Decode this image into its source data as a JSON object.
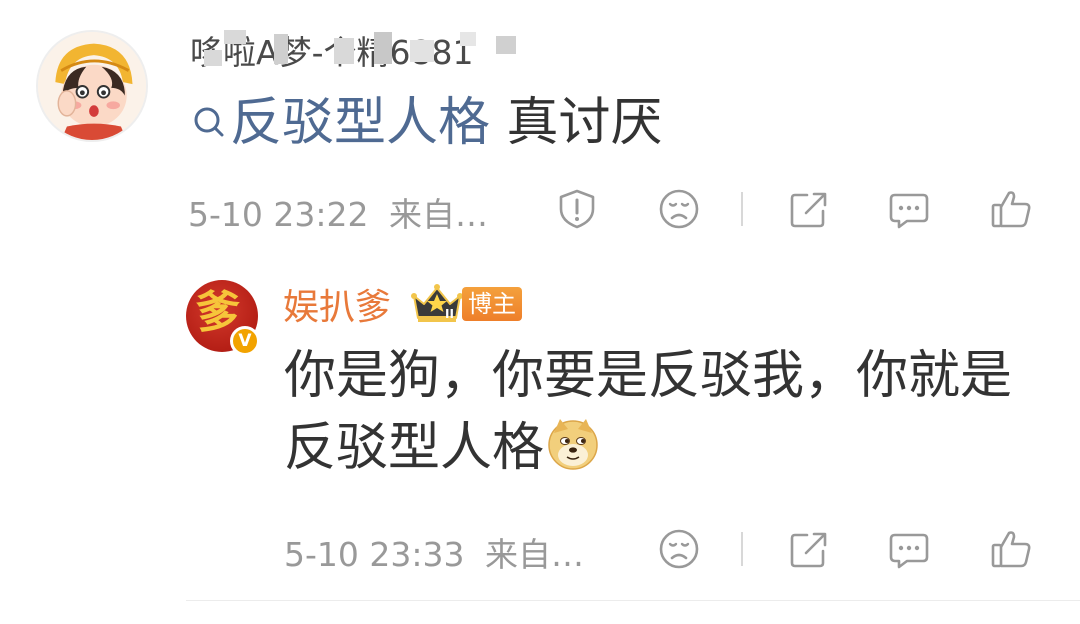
{
  "comment1": {
    "username": "哆啦A梦-个精6881",
    "topic_link": "反驳型人格",
    "text": " 真讨厌",
    "time": "5-10 23:22",
    "source": "来自…",
    "icons": [
      "report-icon",
      "sad-icon",
      "share-icon",
      "comment-icon",
      "like-icon"
    ]
  },
  "comment2": {
    "username": "娱扒爹",
    "badge": "博主",
    "crown_level": "II",
    "verified_mark": "V",
    "avatar_glyph": "爹",
    "text": "你是狗，你要是反驳我，你就是反驳型人格",
    "time": "5-10 23:33",
    "source": "来自…",
    "icons": [
      "sad-icon",
      "share-icon",
      "comment-icon",
      "like-icon"
    ]
  },
  "colors": {
    "link": "#4f6a92",
    "username_orange": "#e8793a",
    "meta_gray": "#999999",
    "icon_gray": "#999999",
    "text": "#333333"
  }
}
